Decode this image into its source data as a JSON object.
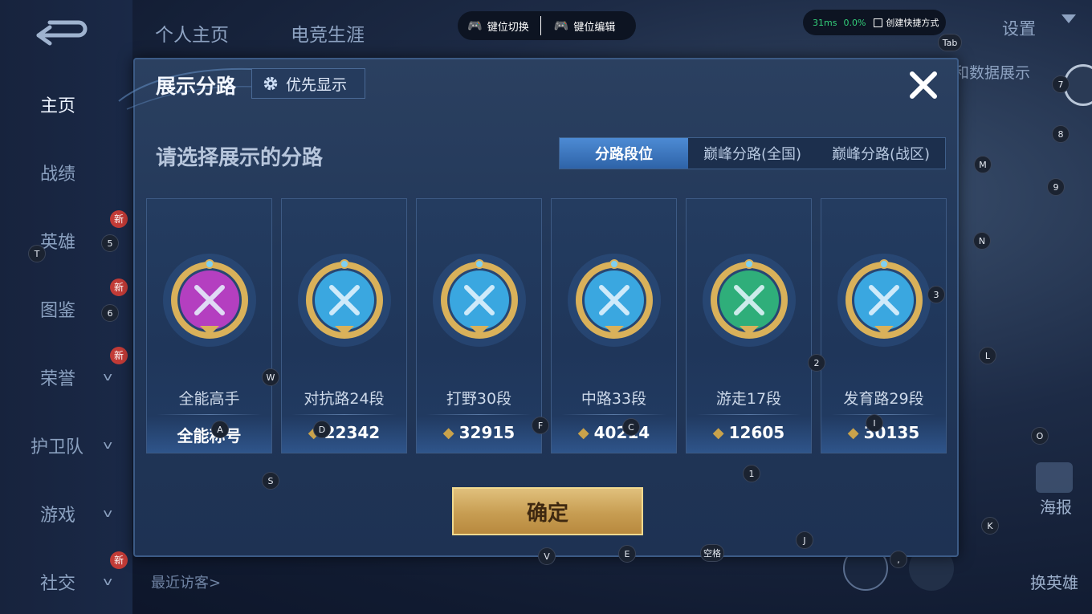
{
  "top_nav": {
    "profile": "个人主页",
    "esports": "电竞生涯",
    "settings": "设置"
  },
  "sidebar": {
    "items": [
      {
        "label": "主页",
        "active": true
      },
      {
        "label": "战绩"
      },
      {
        "label": "英雄",
        "badge": "新"
      },
      {
        "label": "图鉴",
        "badge": "新"
      },
      {
        "label": "荣誉",
        "badge": "新",
        "chevron": true
      },
      {
        "label": "护卫队",
        "chevron": true
      },
      {
        "label": "游戏",
        "chevron": true
      },
      {
        "label": "社交",
        "badge": "新",
        "chevron": true
      }
    ],
    "chevron_glyph": "v"
  },
  "overlay": {
    "key_switch": "键位切换",
    "key_edit": "键位编辑",
    "ping": "31ms",
    "loss": "0.0%",
    "create_shortcut": "创建快捷方式",
    "ping_color": "#33d17a"
  },
  "modal": {
    "title": "展示分路",
    "priority_button": "优先显示",
    "subtitle": "请选择展示的分路",
    "tabs": [
      {
        "label": "分路段位",
        "active": true
      },
      {
        "label": "巅峰分路(全国)"
      },
      {
        "label": "巅峰分路(战区)"
      }
    ],
    "cards": [
      {
        "name": "全能高手",
        "score": "全能称号",
        "emblem": "allround-emblem",
        "color": "#b43fc0"
      },
      {
        "name": "对抗路24段",
        "score": "22342",
        "emblem": "clash-lane-emblem",
        "color": "#3aa7e0"
      },
      {
        "name": "打野30段",
        "score": "32915",
        "emblem": "jungle-emblem",
        "color": "#3aa7e0"
      },
      {
        "name": "中路33段",
        "score": "40214",
        "emblem": "mid-lane-emblem",
        "color": "#3aa7e0"
      },
      {
        "name": "游走17段",
        "score": "12605",
        "emblem": "roam-emblem",
        "color": "#2fae7a"
      },
      {
        "name": "发育路29段",
        "score": "30135",
        "emblem": "farm-lane-emblem",
        "color": "#3aa7e0"
      }
    ],
    "confirm": "确定"
  },
  "background": {
    "right_text": "和数据展示",
    "poster": "海报",
    "change_hero": "换英雄",
    "recent_visitors": "最近访客>"
  },
  "key_markers": [
    "Tab",
    "7",
    "8",
    "M",
    "9",
    "N",
    "3",
    "T",
    "5",
    "6",
    "W",
    "2",
    "L",
    "A",
    "D",
    "F",
    "C",
    "I",
    "O",
    "S",
    "1",
    "K",
    "J",
    "V",
    "E",
    "空格",
    ","
  ]
}
